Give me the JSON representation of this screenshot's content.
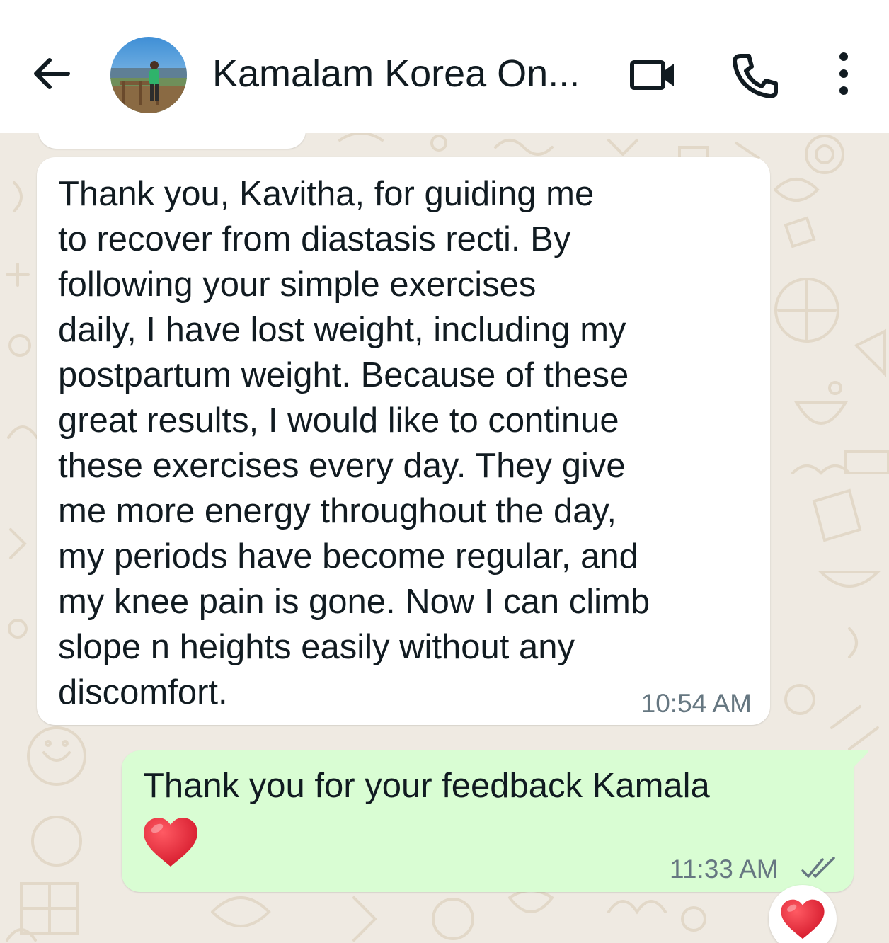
{
  "header": {
    "title": "Kamalam Korea On...",
    "back_icon": "arrow-left-icon",
    "video_icon": "video-camera-icon",
    "call_icon": "phone-icon",
    "menu_icon": "more-vertical-icon"
  },
  "messages": [
    {
      "direction": "incoming",
      "text": "Thank you, Kavitha, for guiding me\nto recover from diastasis recti. By\nfollowing your simple exercises\ndaily, I have lost weight, including my\npostpartum weight. Because of these\ngreat results, I would like to continue\nthese exercises every day. They give\nme more energy throughout the day,\nmy periods have become regular, and\nmy knee pain is gone. Now I can climb\nslope n heights easily without any\ndiscomfort.",
      "time": "10:54 AM"
    },
    {
      "direction": "outgoing",
      "text": "Thank you for your feedback Kamala",
      "emoji": "red-heart",
      "time": "11:33 AM",
      "status_icon": "double-check-icon",
      "reaction": "red-heart"
    }
  ],
  "colors": {
    "background": "#efeae2",
    "incoming_bubble": "#ffffff",
    "outgoing_bubble": "#d9fdd3",
    "text": "#111b21",
    "meta_text": "#667781",
    "heart": "#e8283b"
  }
}
